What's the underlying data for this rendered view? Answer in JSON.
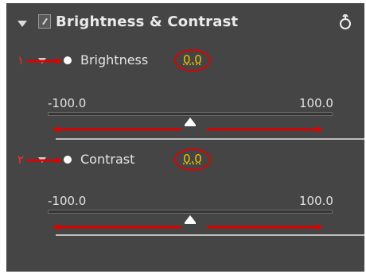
{
  "effect": {
    "title": "Brightness & Contrast",
    "collapse_icon": "triangle-down-icon",
    "fx_icon": "fx-toggle-icon",
    "reset_icon": "reset-icon"
  },
  "params": [
    {
      "marker": "۱",
      "name": "Brightness",
      "value": "0.0",
      "min_label": "-100.0",
      "max_label": "100.0",
      "slider_value": 0.0,
      "slider_min": -100.0,
      "slider_max": 100.0
    },
    {
      "marker": "۲",
      "name": "Contrast",
      "value": "0.0",
      "min_label": "-100.0",
      "max_label": "100.0",
      "slider_value": 0.0,
      "slider_min": -100.0,
      "slider_max": 100.0
    }
  ],
  "colors": {
    "panel_bg": "#454545",
    "value_text": "#f2c200",
    "annotation_red": "#e00000"
  }
}
